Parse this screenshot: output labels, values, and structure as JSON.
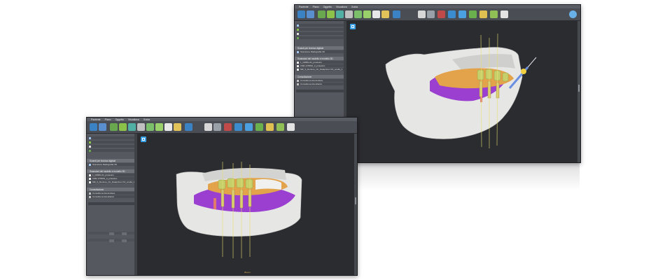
{
  "windows": {
    "back": {
      "menu": [
        "Paziente",
        "Piano",
        "Oggetto",
        "Visualizza",
        "Guida"
      ],
      "panel_headers": [
        "Scandi per tecnica digitale",
        "Scansioni del modello e modello 3D",
        "Consultazione"
      ],
      "panel_rows": [
        "Scansione Radiografia 3D",
        "1_CRMG-01_protesico",
        "CSR-17/0801_3_protesico",
        "MR_S_Denture_On_Dataprimer K3_scelta_1",
        "Consulta senza dentiere",
        "Consulta senza attacco"
      ]
    },
    "front": {
      "menu": [
        "Paziente",
        "Piano",
        "Oggetto",
        "Visualizza",
        "Guida"
      ],
      "panel_headers": [
        "Scandi per tecnica digitale",
        "Scansioni del modello e modello 3D",
        "Consultazione"
      ],
      "panel_rows": [
        "Scansione Radiografia 3D",
        "1_CRMG-01_protesico",
        "CSR-17/0801_3_protesico",
        "MR_S_Denture_On_Dataprimer K3_scelta_1",
        "Consulta senza dentiere",
        "Consulta senza attacco"
      ],
      "status": "Bloom"
    }
  },
  "colors": {
    "bone": "#e6e6e4",
    "gum": "#9a3fd0",
    "teeth": "#e3a34b",
    "implant": "#c6d06a",
    "implant_pin": "#e8e070"
  },
  "icons": [
    "new-icon",
    "open-icon",
    "tooth-icon",
    "implant-icon",
    "guide-icon",
    "ruler-icon",
    "view-icon",
    "layers-icon",
    "screenshot-icon",
    "settings-icon",
    "help-icon"
  ]
}
